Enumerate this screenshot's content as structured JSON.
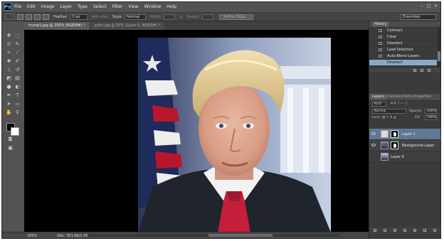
{
  "app": {
    "logo": "Ps",
    "menu": [
      "File",
      "Edit",
      "Image",
      "Layer",
      "Type",
      "Select",
      "Filter",
      "View",
      "Window",
      "Help"
    ],
    "window_buttons": [
      "–",
      "□",
      "×"
    ]
  },
  "options_bar": {
    "feather_label": "Feather:",
    "feather_value": "0 px",
    "anti_alias_label": "Anti-alias",
    "style_label": "Style:",
    "style_value": "Normal",
    "width_label": "Width:",
    "height_label": "Height:",
    "refine_button": "Refine Edge...",
    "workspace": "Essentials"
  },
  "documents": {
    "tabs": [
      {
        "label": "trump1.jpg @ 200% (RGB/8#) *",
        "active": true
      },
      {
        "label": "putin.jpg @ 50% (Layer 0, RGB/8#) *",
        "active": false
      }
    ]
  },
  "status": {
    "zoom": "200%",
    "doc_size": "Doc: 351.8K/1.49M"
  },
  "history": {
    "tab_label": "History",
    "items": [
      "Contract",
      "Clear",
      "Deselect",
      "Load Selection",
      "Auto-Blend Layers",
      "Deselect"
    ],
    "selected_index": 5
  },
  "layers_panel": {
    "tabs": [
      "Layers",
      "Channels",
      "Paths",
      "Properties"
    ],
    "filter_label": "Kind",
    "blend_mode": "Normal",
    "opacity_label": "Opacity:",
    "opacity_value": "100%",
    "lock_label": "Lock:",
    "fill_label": "Fill:",
    "fill_value": "100%",
    "layers": [
      "Layer 1",
      "Background Layer",
      "Layer 0"
    ],
    "selected_index": 0
  },
  "colors": {
    "ui_bg": "#535353",
    "panel_bg": "#3b3b3b",
    "selection": "#8aa9c8",
    "layer_selection": "#5f7896",
    "foreground": "#000000",
    "background": "#ffffff"
  }
}
